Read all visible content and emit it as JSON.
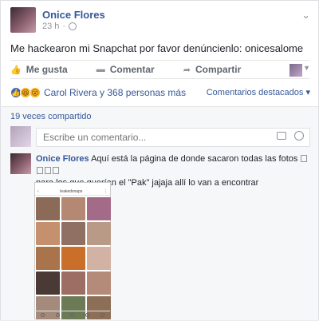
{
  "post": {
    "author": "Onice Flores",
    "time": "23 h",
    "text": "Me hackearon mi Snapchat por favor denúncienlo: onicesalome"
  },
  "actions": {
    "like": "Me gusta",
    "comment": "Comentar",
    "share": "Compartir"
  },
  "reactions": {
    "text": "Carol Rivera y 368 personas más",
    "featured": "Comentarios destacados"
  },
  "comments_section": {
    "shared_count": "19 veces compartido",
    "placeholder": "Escribe un comentario..."
  },
  "comment": {
    "author": "Onice Flores",
    "text_line1": "Aquí está la página de donde sacaron todas las fotos",
    "text_line2": "para los que querían el \"Pak\" jajaja allí lo van a encontrar"
  },
  "screenshot": {
    "profile_name": "leakedsnaps"
  },
  "colors": {
    "link": "#365899",
    "like_blue": "#4267b2",
    "muted": "#90949c"
  }
}
